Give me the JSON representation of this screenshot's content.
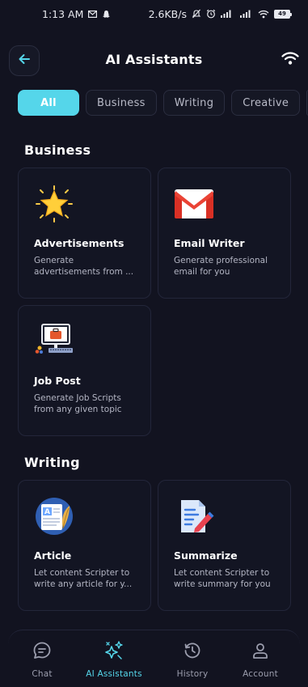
{
  "status_bar": {
    "time": "1:13 AM",
    "net_speed": "2.6KB/s",
    "battery": "49"
  },
  "header": {
    "title": "AI Assistants"
  },
  "tabs": [
    {
      "label": "All",
      "active": true
    },
    {
      "label": "Business",
      "active": false
    },
    {
      "label": "Writing",
      "active": false
    },
    {
      "label": "Creative",
      "active": false
    }
  ],
  "sections": [
    {
      "title": "Business",
      "cards": [
        {
          "title": "Advertisements",
          "description": "Generate advertisements from ...",
          "icon": "star-icon"
        },
        {
          "title": "Email Writer",
          "description": "Generate professional email for you",
          "icon": "gmail-icon"
        },
        {
          "title": "Job Post",
          "description": "Generate Job Scripts from any given topic",
          "icon": "computer-icon"
        }
      ]
    },
    {
      "title": "Writing",
      "cards": [
        {
          "title": "Article",
          "description": "Let content Scripter to write any article for y...",
          "icon": "article-icon"
        },
        {
          "title": "Summarize",
          "description": "Let content Scripter to write summary for you",
          "icon": "summarize-icon"
        }
      ]
    }
  ],
  "bottom_nav": [
    {
      "label": "Chat",
      "icon": "chat-icon",
      "active": false
    },
    {
      "label": "AI Assistants",
      "icon": "ai-sparkle-icon",
      "active": true
    },
    {
      "label": "History",
      "icon": "history-icon",
      "active": false
    },
    {
      "label": "Account",
      "icon": "account-icon",
      "active": false
    }
  ],
  "colors": {
    "background": "#121320",
    "accent": "#55d6ea",
    "card_border": "#23263a",
    "muted_text": "#b3b5c3"
  }
}
